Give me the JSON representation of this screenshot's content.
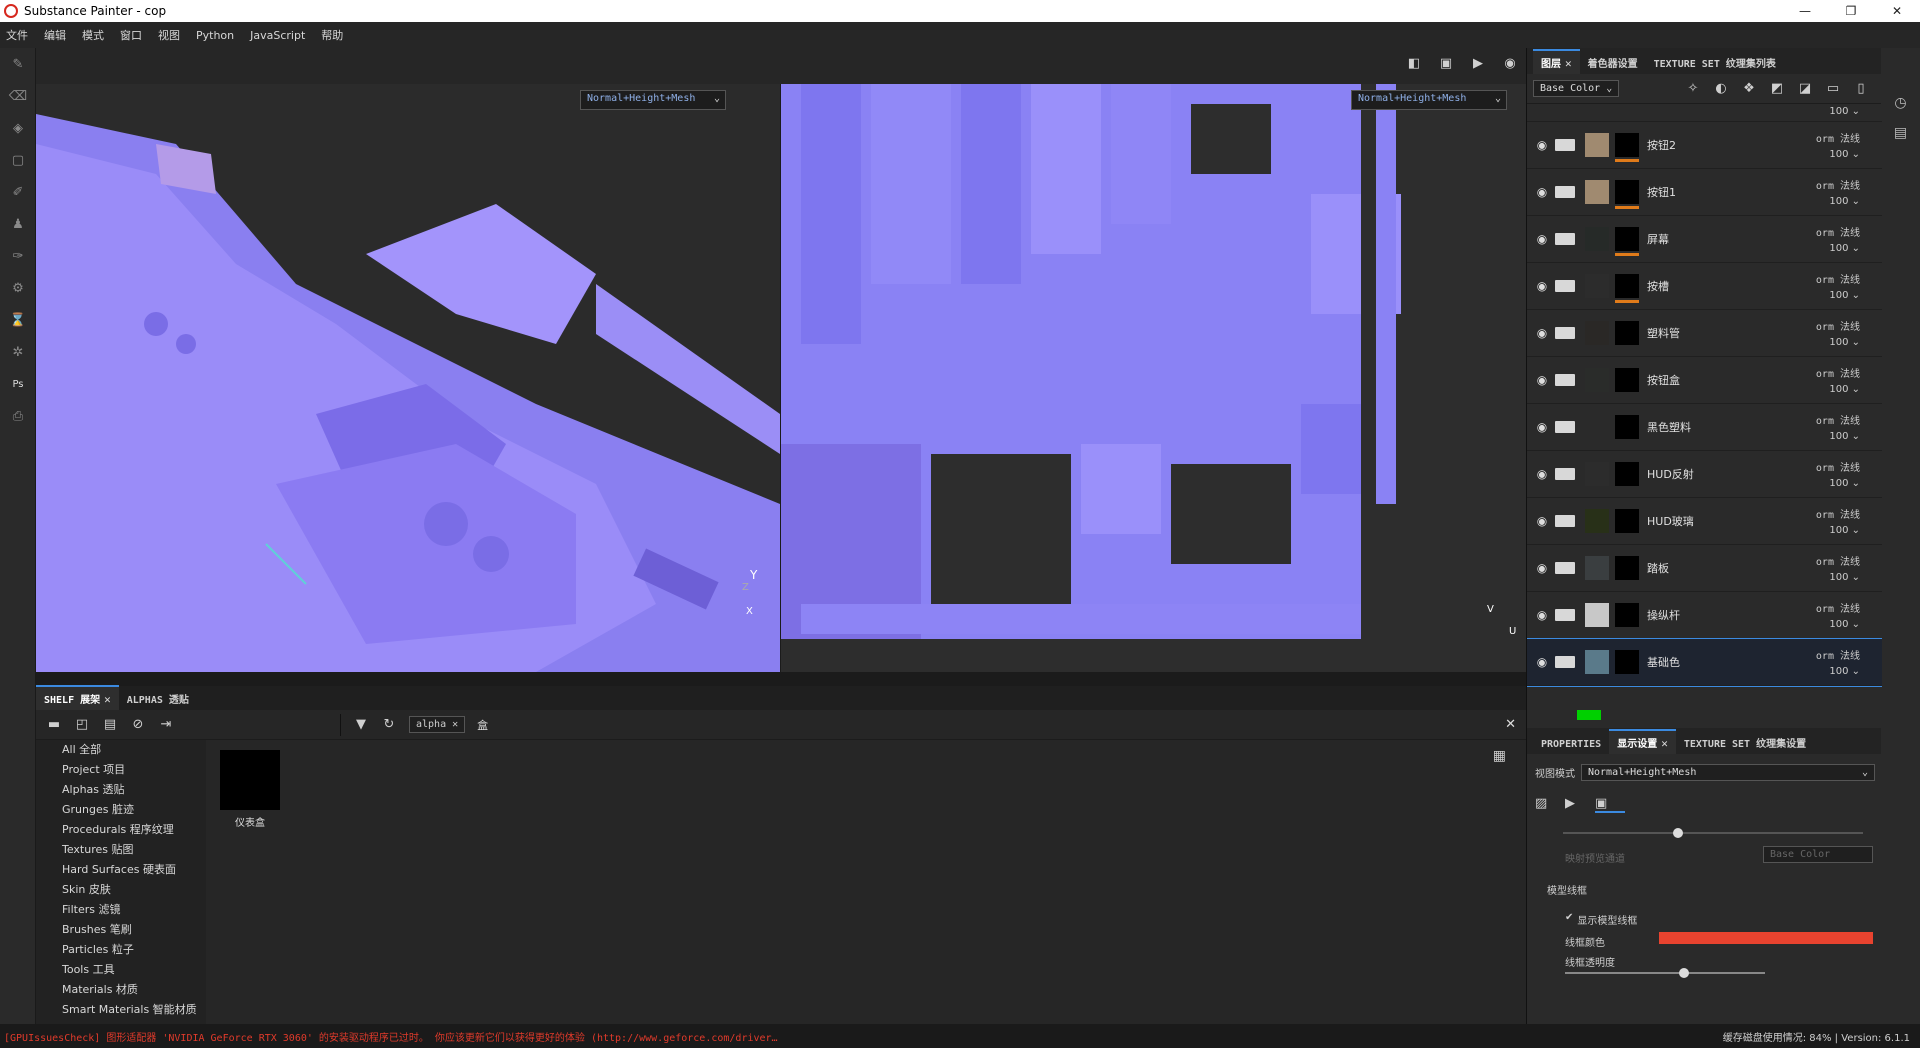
{
  "window": {
    "title": "Substance Painter - cop",
    "min": "—",
    "max": "❐",
    "close": "✕"
  },
  "menu": [
    "文件",
    "编辑",
    "模式",
    "窗口",
    "视图",
    "Python",
    "JavaScript",
    "帮助"
  ],
  "viewport": {
    "mode_left": "Normal+Height+Mesh",
    "mode_right": "Normal+Height+Mesh",
    "axis_y": "Y",
    "axis_x": "X",
    "axis_z": "Z",
    "axis_v": "V",
    "axis_u": "U"
  },
  "layers_panel": {
    "tabs": [
      {
        "label": "图层"
      },
      {
        "label": "着色器设置"
      },
      {
        "label": "TEXTURE SET 纹理集列表"
      }
    ],
    "channel": "Base Color",
    "partial_top_opacity": "100",
    "items": [
      {
        "name": "按钮2",
        "blend": "orm 法线",
        "opacity": "100",
        "thumb": "#a08a70",
        "mask_bar": true
      },
      {
        "name": "按钮1",
        "blend": "orm 法线",
        "opacity": "100",
        "thumb": "#a08a70",
        "mask_bar": true
      },
      {
        "name": "屏幕",
        "blend": "orm 法线",
        "opacity": "100",
        "thumb": "#262a28",
        "mask_bar": true
      },
      {
        "name": "按槽",
        "blend": "orm 法线",
        "opacity": "100",
        "thumb": "#2c2c2c",
        "mask_bar": true
      },
      {
        "name": "塑料管",
        "blend": "orm 法线",
        "opacity": "100",
        "thumb": "#2a2826",
        "mask_bar": false
      },
      {
        "name": "按钮盒",
        "blend": "orm 法线",
        "opacity": "100",
        "thumb": "#2a2c2a",
        "mask_bar": false
      },
      {
        "name": "黑色塑料",
        "blend": "orm 法线",
        "opacity": "100",
        "thumb": "#2a2a2a",
        "mask_bar": false
      },
      {
        "name": "HUD反射",
        "blend": "orm 法线",
        "opacity": "100",
        "thumb": "#2c2c2c",
        "mask_bar": false
      },
      {
        "name": "HUD玻璃",
        "blend": "orm 法线",
        "opacity": "100",
        "thumb": "#283018",
        "mask_bar": false
      },
      {
        "name": "踏板",
        "blend": "orm 法线",
        "opacity": "100",
        "thumb": "#3a3e40",
        "mask_bar": false
      },
      {
        "name": "操纵杆",
        "blend": "orm 法线",
        "opacity": "100",
        "thumb": "#c8c8c8",
        "mask_bar": false
      },
      {
        "name": "基础色",
        "blend": "orm 法线",
        "opacity": "100",
        "thumb": "#5a7a8a",
        "mask_bar": false,
        "selected": true
      }
    ]
  },
  "props_panel": {
    "tabs": [
      {
        "label": "PROPERTIES"
      },
      {
        "label": "显示设置"
      },
      {
        "label": "TEXTURE SET 纹理集设置"
      }
    ],
    "view_mode_label": "视图模式",
    "view_mode_value": "Normal+Height+Mesh",
    "preview_label": "映射预览通道",
    "preview_value": "Base Color",
    "section": "模型线框",
    "show_wire": "显示模型线框",
    "wire_color_label": "线框颜色",
    "wire_color": "#e8432f",
    "wire_opacity_label": "线框透明度",
    "top_slider_value": 0.38,
    "wire_opacity_value": 0.6
  },
  "shelf": {
    "tabs": [
      {
        "label": "SHELF 展架"
      },
      {
        "label": "ALPHAS 透贴"
      }
    ],
    "search_chip": "alpha",
    "filter_text": "盒",
    "categories": [
      "All 全部",
      "Project 项目",
      "Alphas 透贴",
      "Grunges 脏迹",
      "Procedurals 程序纹理",
      "Textures 贴图",
      "Hard Surfaces 硬表面",
      "Skin 皮肤",
      "Filters 滤镜",
      "Brushes 笔刷",
      "Particles 粒子",
      "Tools 工具",
      "Materials 材质",
      "Smart Materials 智能材质"
    ],
    "item": {
      "label": "仪表盒"
    }
  },
  "status": {
    "error": "[GPUIssuesCheck] 图形适配器 'NVIDIA GeForce RTX 3060' 的安装驱动程序已过时。 你应该更新它们以获得更好的体验 (http://www.geforce.com/driver…",
    "right": "缓存磁盘使用情况:  84% | Version: 6.1.1"
  },
  "colors": {
    "accent": "#3b8ae0",
    "normal_map": "#8080ff",
    "error": "#e03a2b",
    "mask_bar": "#e07b1a",
    "green": "#00d000"
  }
}
